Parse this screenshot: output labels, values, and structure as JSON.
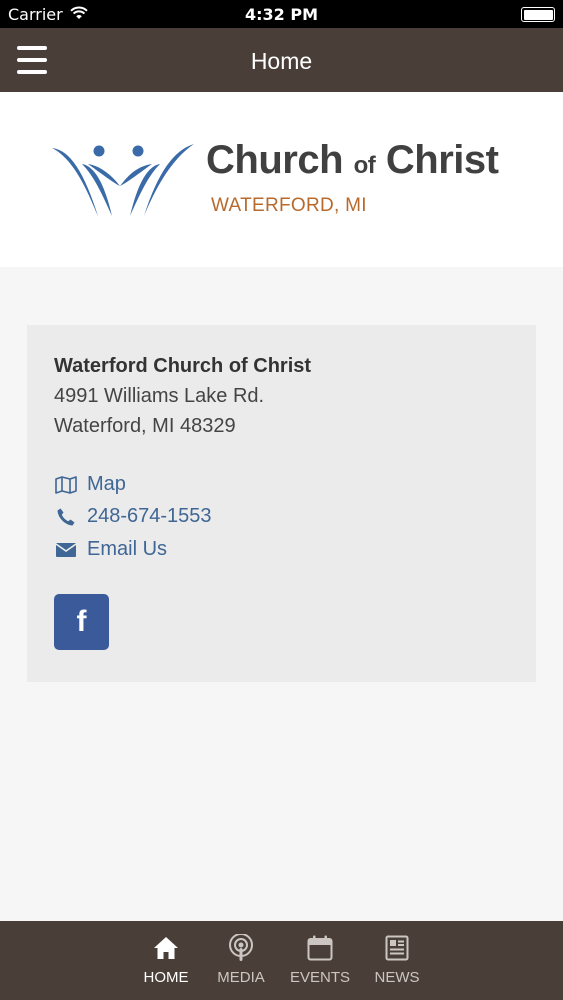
{
  "status_bar": {
    "carrier": "Carrier",
    "time": "4:32 PM"
  },
  "nav": {
    "title": "Home",
    "menu_icon": "hamburger-icon"
  },
  "logo": {
    "title_main": "Church",
    "title_of": "of",
    "title_end": "Christ",
    "subtitle": "WATERFORD, MI",
    "colors": {
      "mark": "#3a6aa7",
      "title": "#404040",
      "subtitle": "#b86a2c"
    }
  },
  "contact": {
    "name": "Waterford Church of Christ",
    "street": "4991 Williams Lake Rd.",
    "city": "Waterford, MI 48329",
    "links": [
      {
        "icon": "map-icon",
        "label": "Map"
      },
      {
        "icon": "phone-icon",
        "label": "248-674-1553"
      },
      {
        "icon": "envelope-icon",
        "label": "Email Us"
      }
    ],
    "facebook": {
      "icon": "facebook-icon",
      "glyph": "f"
    },
    "link_color": "#3f6694"
  },
  "tabs": [
    {
      "label": "HOME",
      "icon": "home-icon",
      "active": true
    },
    {
      "label": "MEDIA",
      "icon": "podcast-icon",
      "active": false
    },
    {
      "label": "EVENTS",
      "icon": "calendar-icon",
      "active": false
    },
    {
      "label": "NEWS",
      "icon": "newspaper-icon",
      "active": false
    }
  ],
  "colors": {
    "bar": "#4a3f38",
    "background": "#f6f6f7",
    "card": "#ebebec",
    "facebook": "#3b5a9a"
  }
}
